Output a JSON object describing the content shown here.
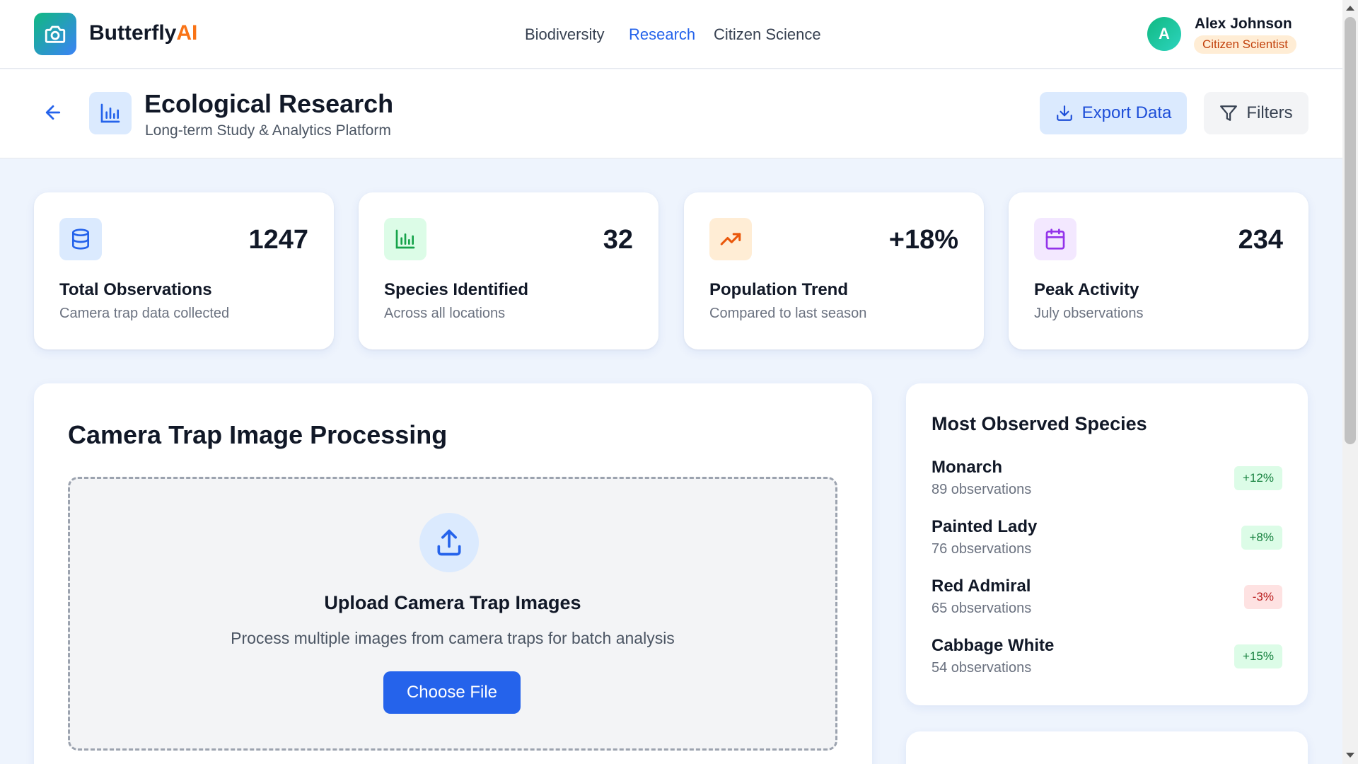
{
  "brand": {
    "name_main": "Butterfly",
    "name_accent": "AI",
    "icon": "camera-icon"
  },
  "nav": [
    {
      "label": "Biodiversity",
      "active": false
    },
    {
      "label": "Research",
      "active": true
    },
    {
      "label": "Citizen Science",
      "active": false
    }
  ],
  "user": {
    "initial": "A",
    "name": "Alex Johnson",
    "role": "Citizen Scientist"
  },
  "header": {
    "title": "Ecological Research",
    "subtitle": "Long-term Study & Analytics Platform",
    "export_label": "Export Data",
    "filters_label": "Filters"
  },
  "stats": [
    {
      "icon": "database-icon",
      "value": "1247",
      "title": "Total Observations",
      "subtitle": "Camera trap data collected",
      "color": "#2563eb",
      "bg": "#dbeafe"
    },
    {
      "icon": "bar-chart-icon",
      "value": "32",
      "title": "Species Identified",
      "subtitle": "Across all locations",
      "color": "#16a34a",
      "bg": "#dcfce7"
    },
    {
      "icon": "trending-up-icon",
      "value": "+18%",
      "title": "Population Trend",
      "subtitle": "Compared to last season",
      "color": "#ea580c",
      "bg": "#ffedd5"
    },
    {
      "icon": "calendar-icon",
      "value": "234",
      "title": "Peak Activity",
      "subtitle": "July observations",
      "color": "#9333ea",
      "bg": "#f3e8ff"
    }
  ],
  "processing": {
    "title": "Camera Trap Image Processing",
    "upload_title": "Upload Camera Trap Images",
    "upload_subtitle": "Process multiple images from camera traps for batch analysis",
    "button_label": "Choose File"
  },
  "species": {
    "title": "Most Observed Species",
    "items": [
      {
        "name": "Monarch",
        "count": "89 observations",
        "change": "+12%",
        "direction": "up"
      },
      {
        "name": "Painted Lady",
        "count": "76 observations",
        "change": "+8%",
        "direction": "up"
      },
      {
        "name": "Red Admiral",
        "count": "65 observations",
        "change": "-3%",
        "direction": "down"
      },
      {
        "name": "Cabbage White",
        "count": "54 observations",
        "change": "+15%",
        "direction": "up"
      }
    ]
  },
  "colors": {
    "accent": "#2563eb",
    "brand_accent": "#f97316",
    "background": "#eef4fd"
  }
}
